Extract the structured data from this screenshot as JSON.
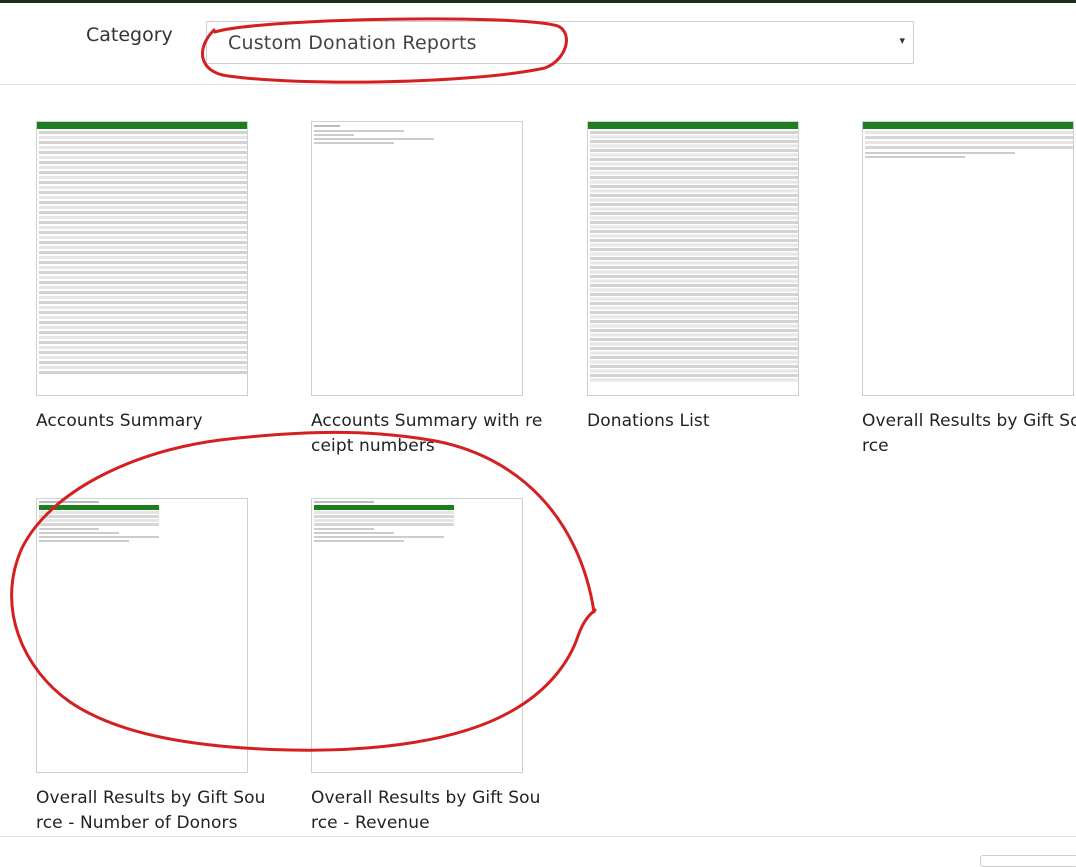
{
  "filter": {
    "label": "Category",
    "selected": "Custom Donation Reports",
    "caret": "▾"
  },
  "reports": [
    {
      "title": "Accounts Summary"
    },
    {
      "title": "Accounts Summary with receipt numbers"
    },
    {
      "title": "Donations List"
    },
    {
      "title": "Overall Results by Gift Source"
    },
    {
      "title": "Overall Results by Gift Source - Number of Donors"
    },
    {
      "title": "Overall Results by Gift Source - Revenue"
    }
  ],
  "colors": {
    "thumbnail_header": "#1e7d1e",
    "annotation": "#d42020"
  }
}
